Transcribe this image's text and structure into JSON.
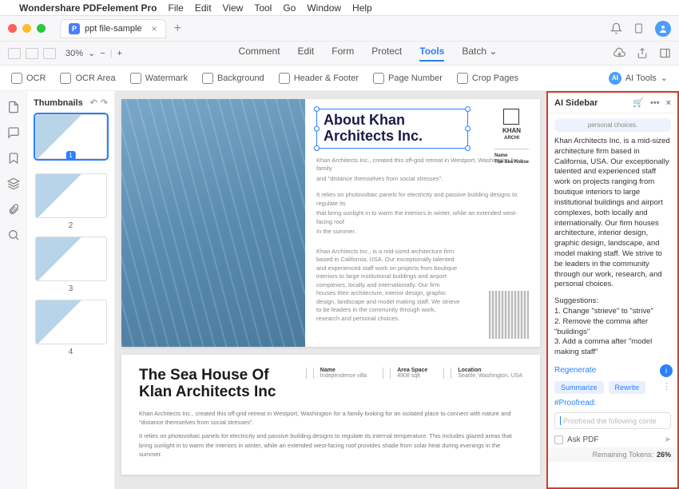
{
  "menubar": {
    "app": "Wondershare PDFelement Pro",
    "items": [
      "File",
      "Edit",
      "View",
      "Tool",
      "Go",
      "Window",
      "Help"
    ]
  },
  "tab": {
    "title": "ppt file-sample"
  },
  "zoom": {
    "value": "30%"
  },
  "main_menu": {
    "items": [
      "Comment",
      "Edit",
      "Form",
      "Protect",
      "Tools",
      "Batch"
    ],
    "active": "Tools"
  },
  "tools_row": {
    "ocr": "OCR",
    "ocr_area": "OCR Area",
    "watermark": "Watermark",
    "background": "Background",
    "header_footer": "Header & Footer",
    "page_number": "Page Number",
    "crop": "Crop Pages",
    "ai": "AI Tools"
  },
  "thumbs": {
    "title": "Thumbnails",
    "labels": [
      "1",
      "2",
      "3",
      "4"
    ]
  },
  "doc": {
    "headline1": "About Khan",
    "headline2": "Architects Inc.",
    "logo": "KHAN",
    "logosub": "ARCHI",
    "tag1": "Name",
    "tag2": "The Sea House",
    "p1a": "Khan Architects Inc., created this off-grid retreat in Westport, Washington for a family",
    "p1b": "and \"distance themselves from social stresses\".",
    "p2a": "It relies on photovoltaic panels for electricity and passive building designs to regulate its",
    "p2b": "that bring sunlight in to warm the interiors in winter, while an extended west-facing roof",
    "p2c": "In the summer.",
    "p3": "Khan Architects Inc., is a mid-sized architecture firm based in California, USA. Our exceptionally talented and experienced staff work on projects from boutique interiors to large institutional buildings and airport complexes, locally and internationally. Our firm houses their architecture, interior design, graphic design, landscape and model making staff. We strieve to be leaders in the community through work, research and personal choices.",
    "page2_h1": "The Sea House Of",
    "page2_h2": "Klan Architects Inc",
    "meta": {
      "name_l": "Name",
      "name_v": "Independence villa",
      "area_l": "Area Space",
      "area_v": "4908 sqft",
      "loc_l": "Location",
      "loc_v": "Seattle, Washington, USA"
    },
    "p4": "Khan Architects Inc., created this off-grid retreat in Westport, Washington for a family looking for an isolated place to connect with nature and \"distance themselves from social stresses\".",
    "p5": "It relies on photovoltaic panels for electricity and passive building designs to regulate its internal temperature. This includes glazed areas that bring sunlight in to warm the interiors in winter, while an extended west-facing roof provides shade from solar heat during evenings in the summer."
  },
  "ai": {
    "title": "AI Sidebar",
    "bubble_top": "personal choices.",
    "response": "Khan Architects Inc. is a mid-sized architecture firm based in California, USA. Our exceptionally talented and experienced staff work on projects ranging from boutique interiors to large institutional buildings and airport complexes, both locally and internationally. Our firm houses architecture, interior design, graphic design, landscape, and model making staff. We strive to be leaders in the community through our work, research, and personal choices.",
    "sugg_h": "Suggestions:",
    "sugg1": "1. Change \"strieve\" to \"strive\"",
    "sugg2": "2. Remove the comma after \"buildings\"",
    "sugg3": "3. Add a comma after \"model making staff\"",
    "regenerate": "Regenerate",
    "chip1": "Summarize",
    "chip2": "Rewrite",
    "proof": "#Proofread:",
    "placeholder": "Proofread the following conte",
    "ask": "Ask PDF",
    "tokens_l": "Remaining Tokens:",
    "tokens_v": "26%"
  }
}
